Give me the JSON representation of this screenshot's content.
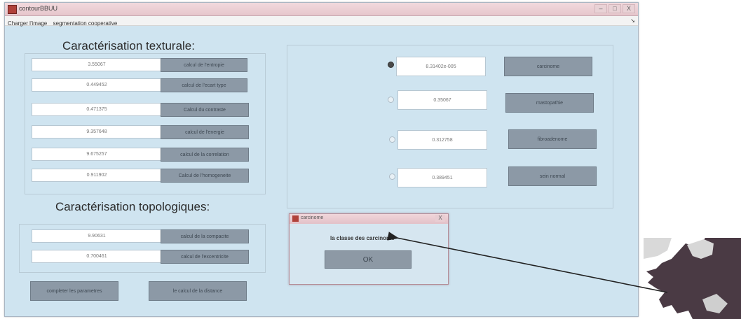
{
  "window": {
    "title": "contourBBUU",
    "menu": [
      "Charger l'image",
      "segmentation cooperative"
    ],
    "menu_end": "↘",
    "controls": [
      "–",
      "□",
      "X"
    ]
  },
  "textural": {
    "title": "Caractérisation texturale:",
    "rows": [
      {
        "value": "3.55067",
        "button": "calcul de l'entropie"
      },
      {
        "value": "0.449452",
        "button": "calcul de l'ecart type"
      },
      {
        "value": "0.471375",
        "button": "Calcul du contraste"
      },
      {
        "value": "9.357648",
        "button": "calcul de l'energie"
      },
      {
        "value": "9.675257",
        "button": "calcul de la correlation"
      },
      {
        "value": "0.911902",
        "button": "Calcul de l'homogeneite"
      }
    ]
  },
  "topological": {
    "title": "Caractérisation topologiques:",
    "rows": [
      {
        "value": "9.90631",
        "button": "calcul de la compacite"
      },
      {
        "value": "0.700461",
        "button": "calcul de l'excentricite"
      }
    ]
  },
  "bottom_buttons": {
    "left": "completer les parametres",
    "right": "le calcul de la distance"
  },
  "classes": {
    "rows": [
      {
        "selected": true,
        "value": "8.31402e-005",
        "button": "carcinome"
      },
      {
        "selected": false,
        "value": "0.35067",
        "button": "mastopathie"
      },
      {
        "selected": false,
        "value": "0.312758",
        "button": "fibroadenome"
      },
      {
        "selected": false,
        "value": "0.389451",
        "button": "sein normal"
      }
    ]
  },
  "dialog": {
    "title": "carcinome",
    "close": "X",
    "message": "la classe des carcinome",
    "ok": "OK"
  },
  "colors": {
    "window_bg": "#cfe4f0",
    "button_bg": "#8c99a6",
    "arrow": "#222222",
    "map_dark": "#4a3a44",
    "map_light": "#d7d7d7"
  }
}
